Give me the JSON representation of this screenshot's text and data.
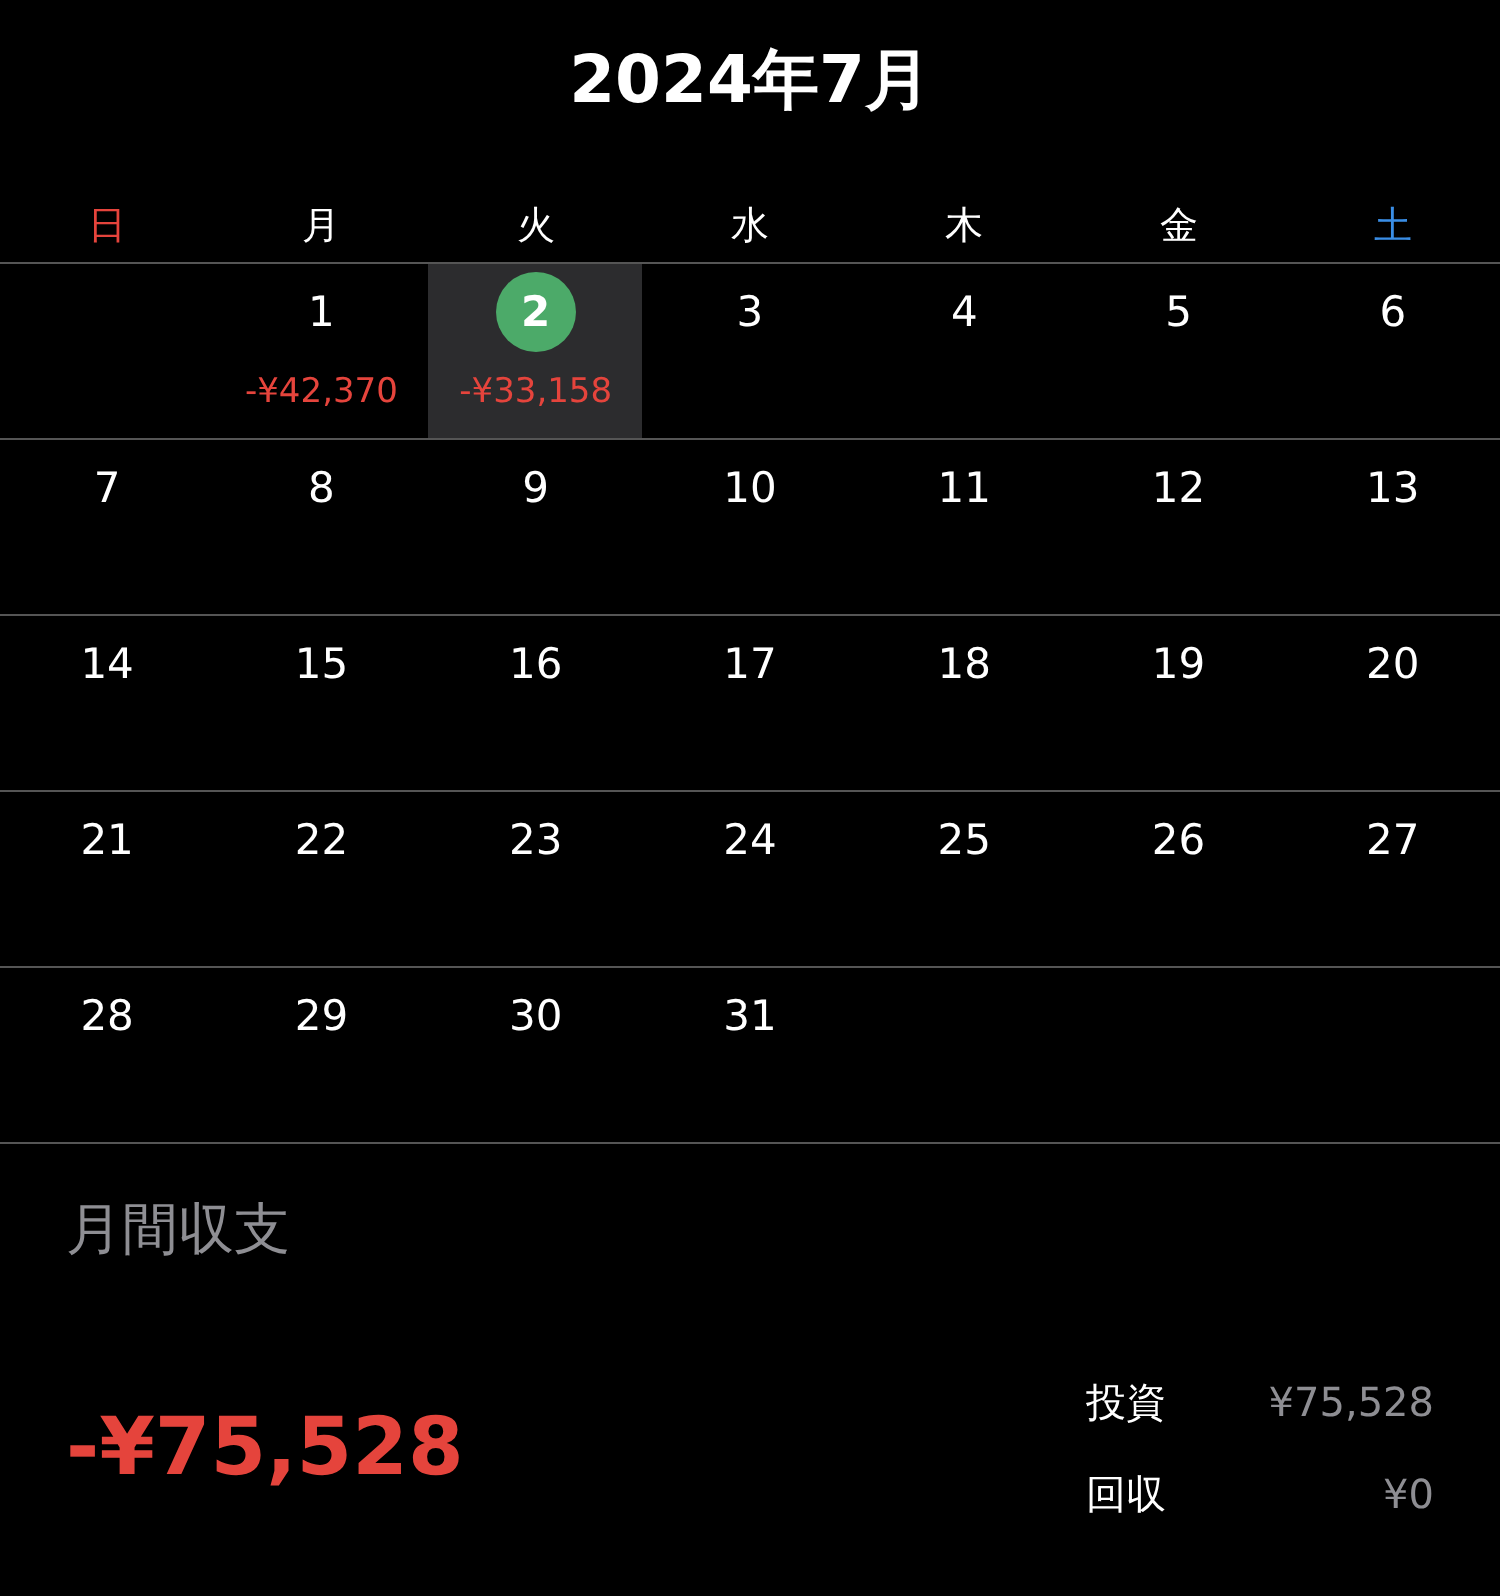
{
  "title": "2024年7月",
  "weekdays": [
    {
      "label": "日",
      "color": "#e5443c"
    },
    {
      "label": "月",
      "color": "#ffffff"
    },
    {
      "label": "火",
      "color": "#ffffff"
    },
    {
      "label": "水",
      "color": "#ffffff"
    },
    {
      "label": "木",
      "color": "#ffffff"
    },
    {
      "label": "金",
      "color": "#ffffff"
    },
    {
      "label": "土",
      "color": "#3a8ee6"
    }
  ],
  "weeks": [
    [
      {
        "kind": "blank"
      },
      {
        "kind": "day",
        "day": "1",
        "selected": false,
        "amount": "-¥42,370"
      },
      {
        "kind": "day",
        "day": "2",
        "selected": true,
        "amount": "-¥33,158"
      },
      {
        "kind": "day",
        "day": "3",
        "selected": false
      },
      {
        "kind": "day",
        "day": "4",
        "selected": false
      },
      {
        "kind": "day",
        "day": "5",
        "selected": false
      },
      {
        "kind": "day",
        "day": "6",
        "selected": false
      }
    ],
    [
      {
        "kind": "day",
        "day": "7",
        "selected": false
      },
      {
        "kind": "day",
        "day": "8",
        "selected": false
      },
      {
        "kind": "day",
        "day": "9",
        "selected": false
      },
      {
        "kind": "day",
        "day": "10",
        "selected": false
      },
      {
        "kind": "day",
        "day": "11",
        "selected": false
      },
      {
        "kind": "day",
        "day": "12",
        "selected": false
      },
      {
        "kind": "day",
        "day": "13",
        "selected": false
      }
    ],
    [
      {
        "kind": "day",
        "day": "14",
        "selected": false
      },
      {
        "kind": "day",
        "day": "15",
        "selected": false
      },
      {
        "kind": "day",
        "day": "16",
        "selected": false
      },
      {
        "kind": "day",
        "day": "17",
        "selected": false
      },
      {
        "kind": "day",
        "day": "18",
        "selected": false
      },
      {
        "kind": "day",
        "day": "19",
        "selected": false
      },
      {
        "kind": "day",
        "day": "20",
        "selected": false
      }
    ],
    [
      {
        "kind": "day",
        "day": "21",
        "selected": false
      },
      {
        "kind": "day",
        "day": "22",
        "selected": false
      },
      {
        "kind": "day",
        "day": "23",
        "selected": false
      },
      {
        "kind": "day",
        "day": "24",
        "selected": false
      },
      {
        "kind": "day",
        "day": "25",
        "selected": false
      },
      {
        "kind": "day",
        "day": "26",
        "selected": false
      },
      {
        "kind": "day",
        "day": "27",
        "selected": false
      }
    ],
    [
      {
        "kind": "day",
        "day": "28",
        "selected": false
      },
      {
        "kind": "day",
        "day": "29",
        "selected": false
      },
      {
        "kind": "day",
        "day": "30",
        "selected": false
      },
      {
        "kind": "day",
        "day": "31",
        "selected": false
      },
      {
        "kind": "blank"
      },
      {
        "kind": "blank"
      },
      {
        "kind": "blank"
      }
    ]
  ],
  "summary": {
    "title": "月間収支",
    "total": "-¥75,528",
    "breakdown": [
      {
        "label": "投資",
        "value": "¥75,528"
      },
      {
        "label": "回収",
        "value": "¥0"
      }
    ]
  }
}
